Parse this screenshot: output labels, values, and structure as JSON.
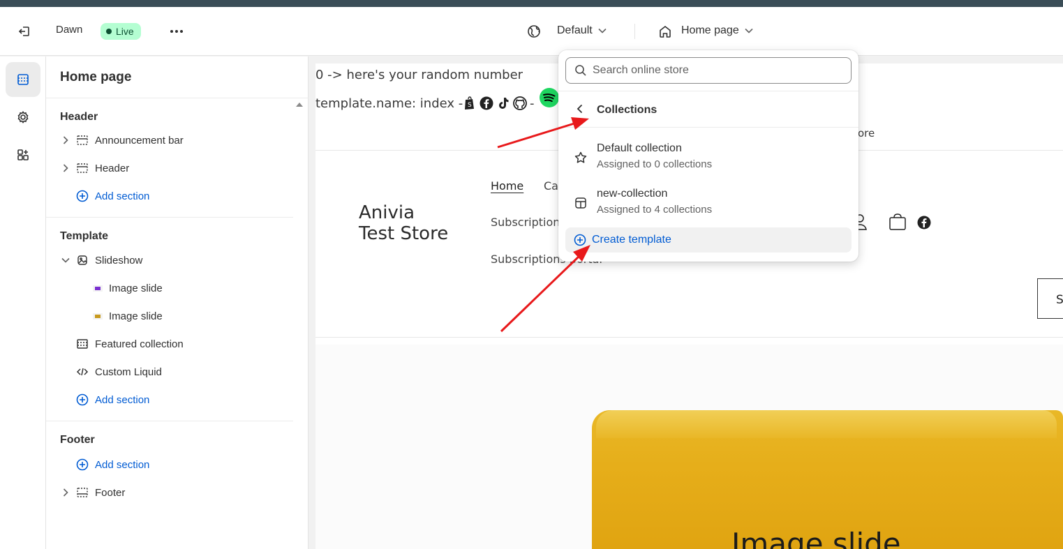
{
  "topbar": {
    "theme_name": "Dawn",
    "live_badge": "Live",
    "market_select": "Default",
    "page_select": "Home page"
  },
  "sidebar": {
    "title": "Home page",
    "groups": {
      "header": {
        "title": "Header",
        "items": [
          "Announcement bar",
          "Header"
        ],
        "add": "Add section"
      },
      "template": {
        "title": "Template",
        "slideshow": "Slideshow",
        "slides": [
          "Image slide",
          "Image slide"
        ],
        "items": [
          "Featured collection",
          "Custom Liquid"
        ],
        "add": "Add section"
      },
      "footer": {
        "title": "Footer",
        "add": "Add section",
        "items": [
          "Footer"
        ]
      }
    }
  },
  "preview": {
    "random_line": "0 -> here's your random number",
    "template_line": "template.name: index -",
    "template_dash": "-",
    "announcement_tail": "ore",
    "store_name_line1": "Anivia",
    "store_name_line2": "Test Store",
    "nav": {
      "home": "Home",
      "partial": "Ca",
      "subscriptions": "Subscription",
      "portal": "Subscriptions portal"
    },
    "search_partial": "S",
    "hero_title": "Image slide",
    "slide_colors": [
      "#7a2fd1",
      "#c89a1e"
    ]
  },
  "popover": {
    "search_placeholder": "Search online store",
    "heading": "Collections",
    "items": [
      {
        "title": "Default collection",
        "sub": "Assigned to 0 collections"
      },
      {
        "title": "new-collection",
        "sub": "Assigned to 4 collections"
      }
    ],
    "create": "Create template"
  },
  "colors": {
    "accent": "#005bd3",
    "live_bg": "#b4fed2",
    "arrow": "#e8191b",
    "spotify": "#1ed760"
  }
}
